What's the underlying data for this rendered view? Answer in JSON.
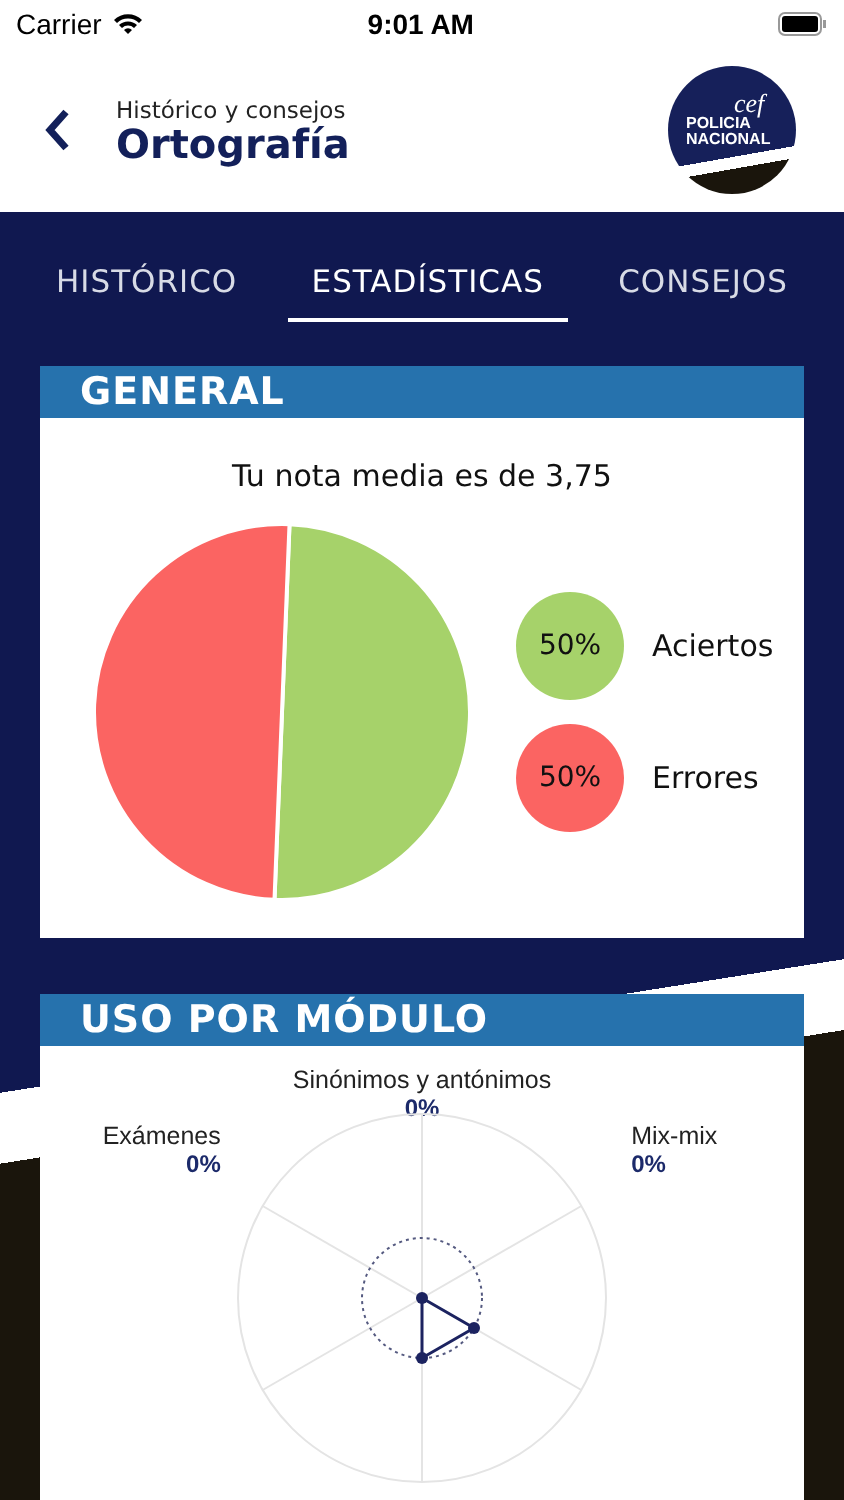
{
  "status_bar": {
    "carrier": "Carrier",
    "time": "9:01 AM"
  },
  "header": {
    "subtitle": "Histórico y consejos",
    "title": "Ortografía",
    "logo": {
      "mark": "cef",
      "line_1": "POLICIA",
      "line_2": "NACIONAL"
    }
  },
  "tabs": [
    {
      "label": "HISTÓRICO",
      "selected": false
    },
    {
      "label": "ESTADÍSTICAS",
      "selected": true
    },
    {
      "label": "CONSEJOS",
      "selected": false
    }
  ],
  "general": {
    "title": "GENERAL",
    "average": "Tu nota media es de 3,75",
    "chart_data": {
      "type": "pie",
      "categories": [
        "Aciertos",
        "Errores"
      ],
      "values": [
        50,
        50
      ]
    },
    "legend": [
      {
        "value": "50%",
        "color": "#a6d26a"
      },
      {
        "value": "50%",
        "color": "#fb6462"
      }
    ]
  },
  "usage": {
    "title": "USO POR MÓDULO",
    "axes": [
      {
        "label": "Sinónimos y antónimos",
        "value": "0%"
      },
      {
        "label": "Exámenes",
        "value": "0%"
      },
      {
        "label": "Mix-mix",
        "value": "0%"
      }
    ]
  }
}
